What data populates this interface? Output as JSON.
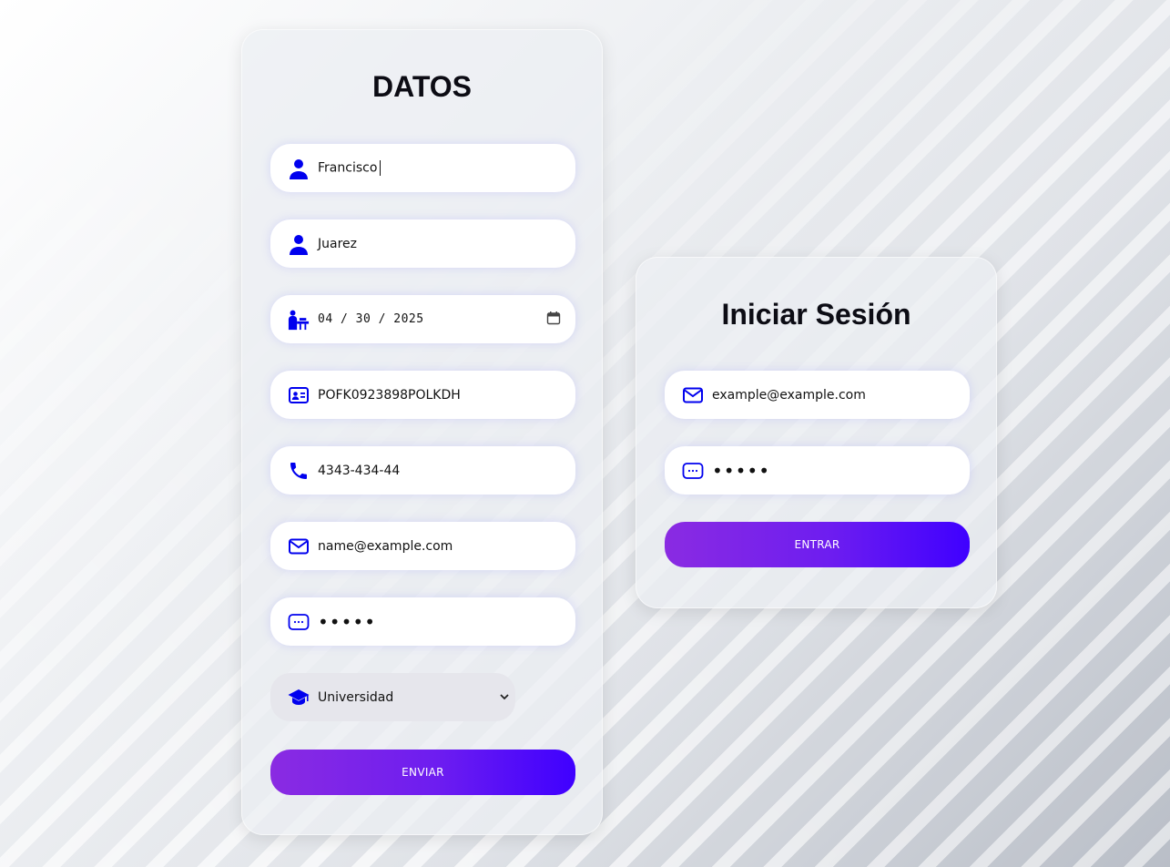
{
  "registration": {
    "title": "DATOS",
    "first_name": "Francisco",
    "last_name": "Juarez",
    "birth_date": "04 / 30 / 2025",
    "id_code": "POFK0923898POLKDH",
    "phone": "4343-434-44",
    "email": "name@example.com",
    "password_mask": "•••••",
    "education_level": "Universidad",
    "submit_label": "ENVIAR"
  },
  "login": {
    "title": "Iniciar Sesión",
    "email": "example@example.com",
    "password_mask": "•••••",
    "submit_label": "ENTRAR"
  },
  "colors": {
    "icon_blue": "#0000ee",
    "button_gradient_start": "#8a2be2",
    "button_gradient_end": "#3f00ff"
  },
  "icons": [
    "user-icon",
    "worker-icon",
    "calendar-icon",
    "id-card-icon",
    "phone-icon",
    "envelope-icon",
    "password-icon",
    "graduation-cap-icon",
    "chevron-down-icon"
  ]
}
